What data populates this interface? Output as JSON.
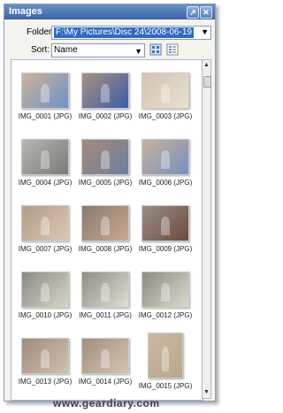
{
  "window": {
    "title": "Images"
  },
  "folder": {
    "label": "Folder:",
    "value": "F:\\My Pictures\\Disc 24\\2008-06-19"
  },
  "sort": {
    "label": "Sort:",
    "value": "Name"
  },
  "thumbnails": [
    {
      "caption": "IMG_0001 (JPG)",
      "orientation": "landscape",
      "colors": [
        "#c9b59a",
        "#6f90c8"
      ]
    },
    {
      "caption": "IMG_0002 (JPG)",
      "orientation": "landscape",
      "colors": [
        "#a89080",
        "#3b5fa8"
      ]
    },
    {
      "caption": "IMG_0003 (JPG)",
      "orientation": "landscape",
      "colors": [
        "#d2c4b0",
        "#e9e0cf"
      ]
    },
    {
      "caption": "IMG_0004 (JPG)",
      "orientation": "landscape",
      "colors": [
        "#b9b7b2",
        "#7c7a76"
      ]
    },
    {
      "caption": "IMG_0005 (JPG)",
      "orientation": "landscape",
      "colors": [
        "#a48a78",
        "#6e7fa0"
      ]
    },
    {
      "caption": "IMG_0006 (JPG)",
      "orientation": "landscape",
      "colors": [
        "#c7b29c",
        "#7690c0"
      ]
    },
    {
      "caption": "IMG_0007 (JPG)",
      "orientation": "landscape",
      "colors": [
        "#b39c88",
        "#d9c7b3"
      ]
    },
    {
      "caption": "IMG_0008 (JPG)",
      "orientation": "landscape",
      "colors": [
        "#8a7a6e",
        "#c9a990"
      ]
    },
    {
      "caption": "IMG_0009 (JPG)",
      "orientation": "landscape",
      "colors": [
        "#9a8f86",
        "#6e4a3c"
      ]
    },
    {
      "caption": "IMG_0010 (JPG)",
      "orientation": "landscape",
      "colors": [
        "#8b8a82",
        "#d8d4c8"
      ]
    },
    {
      "caption": "IMG_0011 (JPG)",
      "orientation": "landscape",
      "colors": [
        "#8f8c84",
        "#e0dcd2"
      ]
    },
    {
      "caption": "IMG_0012 (JPG)",
      "orientation": "landscape",
      "colors": [
        "#8d8a80",
        "#dcd8cc"
      ]
    },
    {
      "caption": "IMG_0013 (JPG)",
      "orientation": "landscape",
      "colors": [
        "#9e8d7c",
        "#d0c0b0"
      ]
    },
    {
      "caption": "IMG_0014 (JPG)",
      "orientation": "landscape",
      "colors": [
        "#a08f7e",
        "#d4c4b2"
      ]
    },
    {
      "caption": "IMG_0015 (JPG)",
      "orientation": "portrait",
      "colors": [
        "#cbb8a4",
        "#b8a88c"
      ]
    }
  ],
  "icons": {
    "pin": "pin-icon",
    "close": "close-icon",
    "view_list": "thumbnail-view-icon",
    "view_detail": "detail-view-icon"
  },
  "watermark": "www.geardiary.com"
}
